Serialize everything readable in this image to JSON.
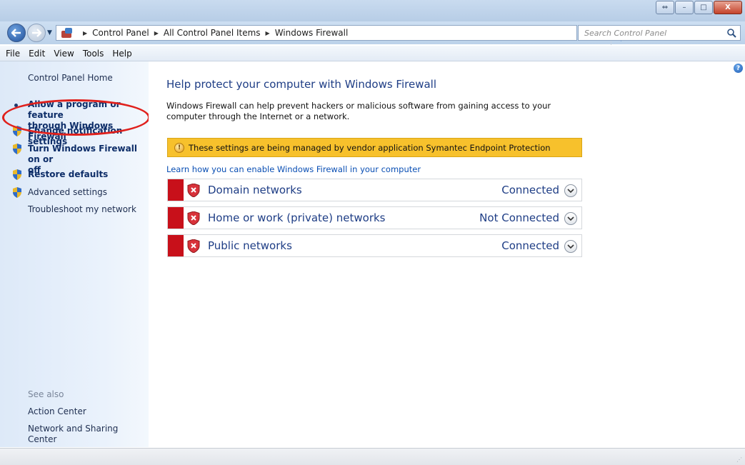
{
  "window": {
    "buttons": {
      "back_forward": "⇔",
      "minimize": "–",
      "maximize": "□",
      "close": "X"
    }
  },
  "address_bar": {
    "breadcrumbs": [
      "Control Panel",
      "All Control Panel Items",
      "Windows Firewall"
    ],
    "search_placeholder": "Search Control Panel"
  },
  "menu": [
    "File",
    "Edit",
    "View",
    "Tools",
    "Help"
  ],
  "sidebar": {
    "home": "Control Panel Home",
    "items": [
      {
        "label": "Allow a program or feature through Windows Firewall",
        "line1": "Allow a program or feature",
        "line2": "through Windows Firewall"
      },
      {
        "label": "Change notification settings"
      },
      {
        "label": "Turn Windows Firewall on or off",
        "line1": "Turn Windows Firewall on or",
        "line2": "off"
      },
      {
        "label": "Restore defaults"
      },
      {
        "label": "Advanced settings"
      },
      {
        "label": "Troubleshoot my network"
      }
    ],
    "see_also": {
      "heading": "See also",
      "links": [
        "Action Center",
        "Network and Sharing Center"
      ]
    }
  },
  "main": {
    "title": "Help protect your computer with Windows Firewall",
    "description": "Windows Firewall can help prevent hackers or malicious software from gaining access to your computer through the Internet or a network.",
    "banner": "These settings are being managed by vendor application Symantec Endpoint Protection",
    "learn_link": "Learn how you can enable Windows Firewall in your computer",
    "networks": [
      {
        "name": "Domain networks",
        "status": "Connected"
      },
      {
        "name": "Home or work (private) networks",
        "status": "Not Connected"
      },
      {
        "name": "Public networks",
        "status": "Connected"
      }
    ]
  },
  "colors": {
    "accent_red": "#c8101a",
    "banner_yellow": "#f7c12c",
    "link_blue": "#0a4fb4",
    "heading_blue": "#1e3d85",
    "annotation_ring": "#e0201c"
  }
}
